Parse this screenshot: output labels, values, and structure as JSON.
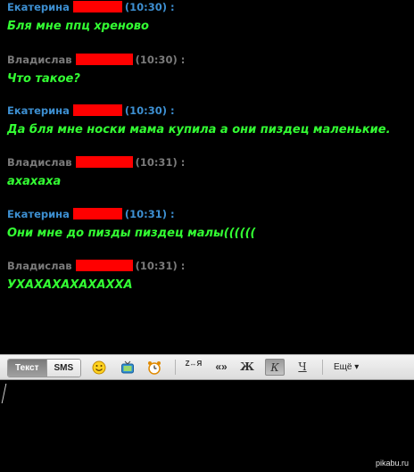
{
  "messages": [
    {
      "author": "Екатерина",
      "time": "(10:30) :",
      "text": "Бля мне ппц хреново"
    },
    {
      "author": "Владислав",
      "time": "(10:30) :",
      "text": "Что такое?"
    },
    {
      "author": "Екатерина",
      "time": "(10:30) :",
      "text": "Да бля мне носки мама купила а они пиздец маленькие."
    },
    {
      "author": "Владислав",
      "time": "(10:31) :",
      "text": "ахахаха"
    },
    {
      "author": "Екатерина",
      "time": "(10:31) :",
      "text": "Они мне до пизды пиздец малы(((((("
    },
    {
      "author": "Владислав",
      "time": "(10:31) :",
      "text": "УХАХАХАХАХАХХА"
    }
  ],
  "toolbar": {
    "tab_text": "Текст",
    "tab_sms": "SMS",
    "translit_label": "Z↔Я",
    "quote_label": "«»",
    "bold_label": "Ж",
    "italic_label": "К",
    "underline_label": "Ч",
    "more_label": "Ещё ▾",
    "icons": [
      "smiley-icon",
      "tv-icon",
      "alarm-icon"
    ]
  },
  "colors": {
    "background": "#000000",
    "self_name": "#3d8fd1",
    "other_name": "#7a7a7a",
    "message_text": "#33ff33",
    "redaction": "#ff0000"
  },
  "watermark": "pikabu.ru"
}
